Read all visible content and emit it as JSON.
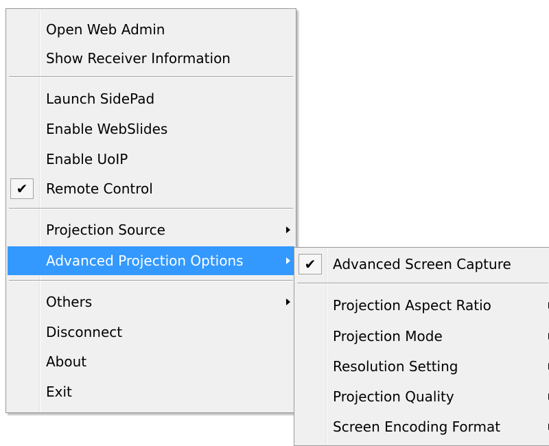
{
  "main_menu": {
    "items": [
      {
        "label": "Open Web Admin"
      },
      {
        "label": "Show Receiver Information"
      },
      {
        "label": "Launch SidePad"
      },
      {
        "label": "Enable WebSlides"
      },
      {
        "label": "Enable UoIP"
      },
      {
        "label": "Remote Control",
        "checked": true,
        "check_glyph": "✔"
      },
      {
        "label": "Projection Source",
        "has_submenu": true
      },
      {
        "label": "Advanced Projection Options",
        "has_submenu": true,
        "highlighted": true
      },
      {
        "label": "Others",
        "has_submenu": true
      },
      {
        "label": "Disconnect"
      },
      {
        "label": "About"
      },
      {
        "label": "Exit"
      }
    ]
  },
  "sub_menu": {
    "items": [
      {
        "label": "Advanced Screen Capture",
        "checked": true,
        "check_glyph": "✔"
      },
      {
        "label": "Projection Aspect Ratio",
        "has_submenu": true
      },
      {
        "label": "Projection Mode",
        "has_submenu": true
      },
      {
        "label": "Resolution Setting",
        "has_submenu": true
      },
      {
        "label": "Projection Quality",
        "has_submenu": true
      },
      {
        "label": "Screen Encoding Format",
        "has_submenu": true
      }
    ]
  },
  "icons": {
    "check": "check-icon",
    "submenu_arrow": "submenu-arrow-icon"
  },
  "colors": {
    "menu_background": "#f0f0f0",
    "highlight_background": "#3399ff",
    "highlight_text": "#ffffff",
    "text": "#000000"
  }
}
